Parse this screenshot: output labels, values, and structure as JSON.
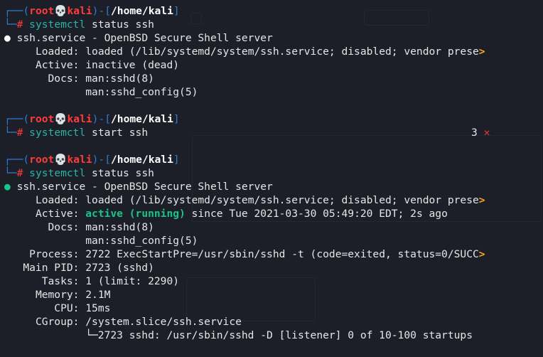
{
  "prompt": {
    "user": "root",
    "skull": "💀",
    "host": "kali",
    "path": "/home/kali",
    "symbol": "#"
  },
  "blocks": [
    {
      "command": "systemctl status ssh"
    },
    {
      "command": "systemctl start ssh"
    },
    {
      "command": "systemctl status ssh"
    }
  ],
  "status1": {
    "title": "ssh.service - OpenBSD Secure Shell server",
    "loaded_label": "Loaded:",
    "loaded_value": "loaded (/lib/systemd/system/ssh.service; disabled; vendor prese",
    "active_label": "Active:",
    "active_value": "inactive (dead)",
    "docs_label": "Docs:",
    "docs_1": "man:sshd(8)",
    "docs_2": "man:sshd_config(5)"
  },
  "start_line": {
    "count": "3",
    "x": "✕"
  },
  "status2": {
    "title": "ssh.service - OpenBSD Secure Shell server",
    "loaded_label": "Loaded:",
    "loaded_value": "loaded (/lib/systemd/system/ssh.service; disabled; vendor prese",
    "active_label": "Active:",
    "active_state": "active (running)",
    "active_since": "since Tue 2021-03-30 05:49:20 EDT; 2s ago",
    "docs_label": "Docs:",
    "docs_1": "man:sshd(8)",
    "docs_2": "man:sshd_config(5)",
    "process_label": "Process:",
    "process_value": "2722 ExecStartPre=/usr/sbin/sshd -t (code=exited, status=0/SUCC",
    "mainpid_label": "Main PID:",
    "mainpid_value": "2723 (sshd)",
    "tasks_label": "Tasks:",
    "tasks_value": "1 (limit: 2290)",
    "memory_label": "Memory:",
    "memory_value": "2.1M",
    "cpu_label": "CPU:",
    "cpu_value": "15ms",
    "cgroup_label": "CGroup:",
    "cgroup_value": "/system.slice/ssh.service",
    "cgroup_child": "└─2723 sshd: /usr/sbin/sshd -D [listener] 0 of 10-100 startups"
  },
  "truncation_marker": ">",
  "colors": {
    "background": "#1c1f28",
    "prompt_blue": "#2f7bd6",
    "user_red": "#ff3b3b",
    "command_teal": "#2bb3a6",
    "active_green": "#19c48a",
    "truncate_orange": "#f5a623"
  }
}
